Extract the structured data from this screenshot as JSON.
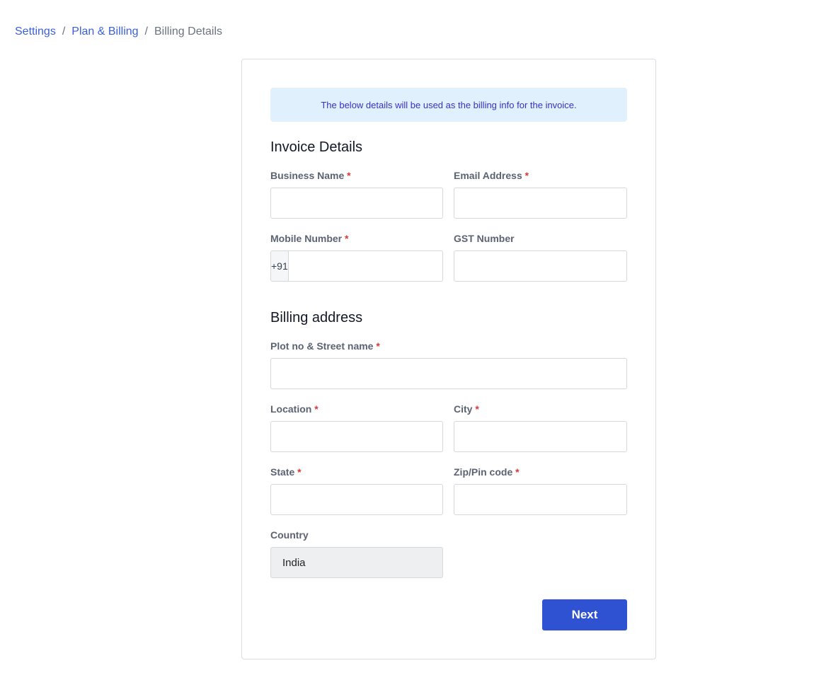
{
  "breadcrumb": {
    "items": [
      "Settings",
      "Plan & Billing"
    ],
    "separator": "/",
    "current": "Billing Details"
  },
  "notice": {
    "text": "The below details will be used as the billing info for the invoice."
  },
  "invoice": {
    "title": "Invoice Details",
    "business_name": {
      "label": "Business Name",
      "required_mark": "*",
      "value": ""
    },
    "email": {
      "label": "Email Address",
      "required_mark": "*",
      "value": ""
    },
    "mobile": {
      "label": "Mobile Number",
      "required_mark": "*",
      "prefix": "+91",
      "value": ""
    },
    "gst": {
      "label": "GST Number",
      "value": ""
    }
  },
  "billing": {
    "title": "Billing address",
    "street": {
      "label": "Plot no & Street name",
      "required_mark": "*",
      "value": ""
    },
    "location": {
      "label": "Location",
      "required_mark": "*",
      "value": ""
    },
    "city": {
      "label": "City",
      "required_mark": "*",
      "value": ""
    },
    "state": {
      "label": "State",
      "required_mark": "*",
      "value": ""
    },
    "zip": {
      "label": "Zip/Pin code",
      "required_mark": "*",
      "value": ""
    },
    "country": {
      "label": "Country",
      "value": "India"
    }
  },
  "actions": {
    "next_label": "Next"
  },
  "colors": {
    "accent": "#2f52d3",
    "link": "#3b5fd9",
    "notice_bg": "#e1f0fd",
    "required": "#d9383a"
  }
}
